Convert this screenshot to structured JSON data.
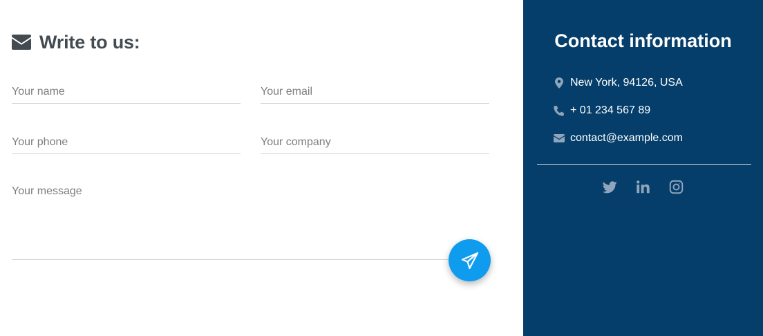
{
  "form": {
    "heading": "Write to us:",
    "fields": {
      "name_placeholder": "Your name",
      "email_placeholder": "Your email",
      "phone_placeholder": "Your phone",
      "company_placeholder": "Your company",
      "message_placeholder": "Your message"
    },
    "submit_icon": "paper-plane-icon"
  },
  "contact": {
    "title": "Contact information",
    "address": "New York, 94126, USA",
    "phone": "+ 01 234 567 89",
    "email": "contact@example.com",
    "socials": [
      "twitter-icon",
      "linkedin-icon",
      "instagram-icon"
    ]
  },
  "colors": {
    "panel_bg": "#053e6a",
    "accent": "#0f9cee",
    "heading_text": "#444b50",
    "icon_muted": "#8fa5bb"
  }
}
